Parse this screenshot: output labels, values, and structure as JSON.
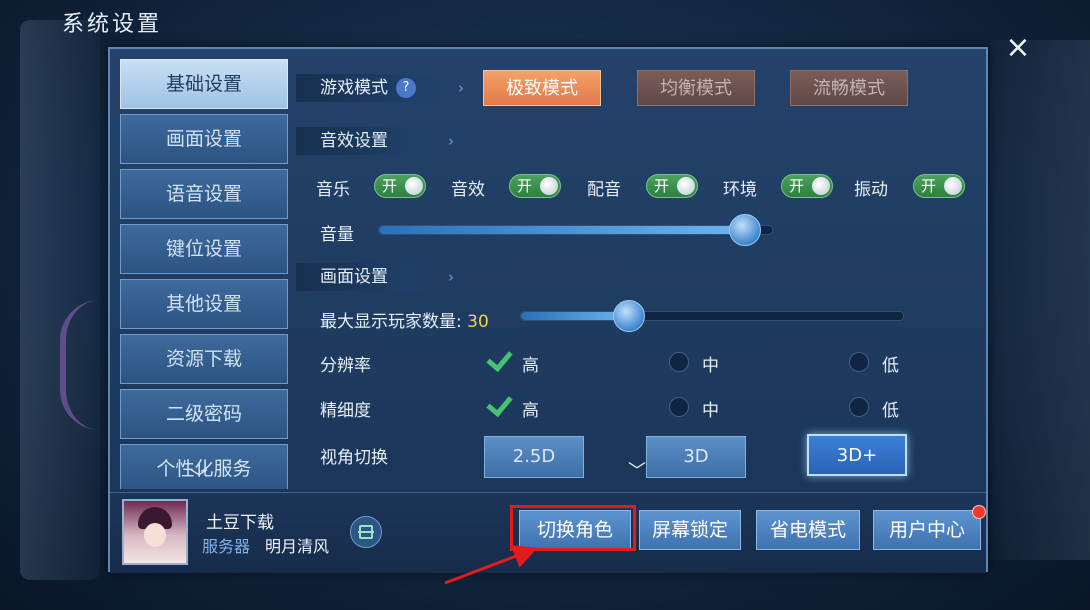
{
  "window": {
    "title": "系统设置",
    "close_icon": "×"
  },
  "sidebar": {
    "items": [
      {
        "label": "基础设置",
        "active": true
      },
      {
        "label": "画面设置"
      },
      {
        "label": "语音设置"
      },
      {
        "label": "键位设置"
      },
      {
        "label": "其他设置"
      },
      {
        "label": "资源下载"
      },
      {
        "label": "二级密码"
      },
      {
        "label": "个性化服务"
      }
    ]
  },
  "game_mode": {
    "header": "游戏模式",
    "help": "?",
    "options": [
      "极致模式",
      "均衡模式",
      "流畅模式"
    ],
    "selected": "极致模式"
  },
  "sound": {
    "header": "音效设置",
    "toggles": [
      {
        "label": "音乐",
        "state": "开"
      },
      {
        "label": "音效",
        "state": "开"
      },
      {
        "label": "配音",
        "state": "开"
      },
      {
        "label": "环境",
        "state": "开"
      },
      {
        "label": "振动",
        "state": "开"
      }
    ],
    "volume_label": "音量",
    "volume_level": 0.93
  },
  "display": {
    "header": "画面设置",
    "max_players_label": "最大显示玩家数量:",
    "max_players_value": "30",
    "max_players_level": 0.28,
    "resolution": {
      "label": "分辨率",
      "options": [
        "高",
        "中",
        "低"
      ],
      "selected": "高"
    },
    "detail": {
      "label": "精细度",
      "options": [
        "高",
        "中",
        "低"
      ],
      "selected": "高"
    },
    "view": {
      "label": "视角切换",
      "options": [
        "2.5D",
        "3D",
        "3D+"
      ],
      "selected": "3D+"
    }
  },
  "footer": {
    "user_name": "土豆下载",
    "server_label": "服务器",
    "server_name": "明月清风",
    "buttons": [
      "切换角色",
      "屏幕锁定",
      "省电模式",
      "用户中心"
    ]
  },
  "colors": {
    "accent_active": "#e2784a",
    "toggle_on": "#2e7f43",
    "highlight": "#e41b1b",
    "value_text": "#f6d24a"
  }
}
